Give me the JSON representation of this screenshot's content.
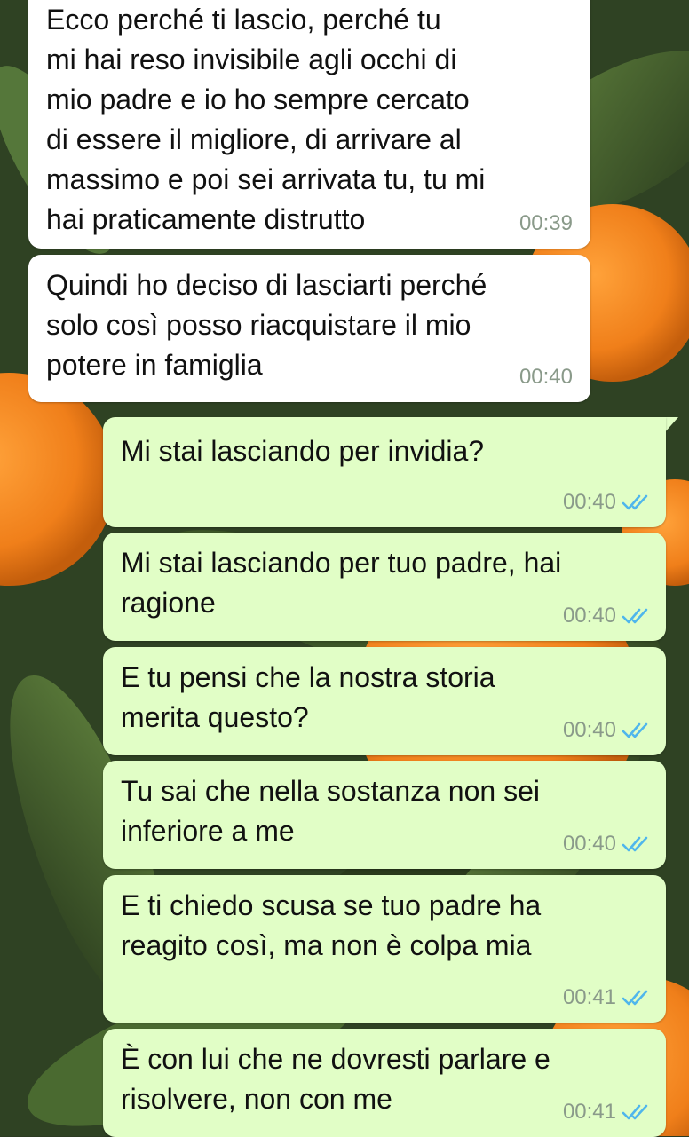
{
  "chat": {
    "messages": [
      {
        "direction": "incoming",
        "text": "Ecco perché ti lascio, perché tu\nmi hai reso invisibile agli occhi di\nmio padre e io ho sempre cercato\ndi essere il migliore, di arrivare al\nmassimo e poi sei arrivata tu, tu mi\nhai praticamente distrutto",
        "time": "00:39"
      },
      {
        "direction": "incoming",
        "text": "Quindi ho deciso di lasciarti perché\nsolo così posso riacquistare il mio\npotere in famiglia",
        "time": "00:40"
      },
      {
        "direction": "outgoing",
        "text": "Mi stai lasciando per invidia?",
        "time": "00:40",
        "status": "read"
      },
      {
        "direction": "outgoing",
        "text": "Mi stai lasciando per tuo padre, hai\nragione",
        "time": "00:40",
        "status": "read"
      },
      {
        "direction": "outgoing",
        "text": "E tu pensi che la nostra storia\nmerita questo?",
        "time": "00:40",
        "status": "read"
      },
      {
        "direction": "outgoing",
        "text": "Tu sai che nella sostanza non sei\ninferiore a me",
        "time": "00:40",
        "status": "read"
      },
      {
        "direction": "outgoing",
        "text": "E ti chiedo scusa se tuo padre ha\nreagito così, ma non è colpa mia",
        "time": "00:41",
        "status": "read"
      },
      {
        "direction": "outgoing",
        "text": "È con lui che ne dovresti parlare e\nrisolvere, non con me",
        "time": "00:41",
        "status": "read"
      }
    ],
    "status_icon": "double-check-icon"
  },
  "colors": {
    "incoming_bubble": "#ffffff",
    "outgoing_bubble": "#e1fec6",
    "read_ticks": "#4fb6ec",
    "timestamp": "#8a9a8a",
    "wallpaper_orange": "#f07f1a",
    "wallpaper_leaf": "#3f5a2c"
  }
}
